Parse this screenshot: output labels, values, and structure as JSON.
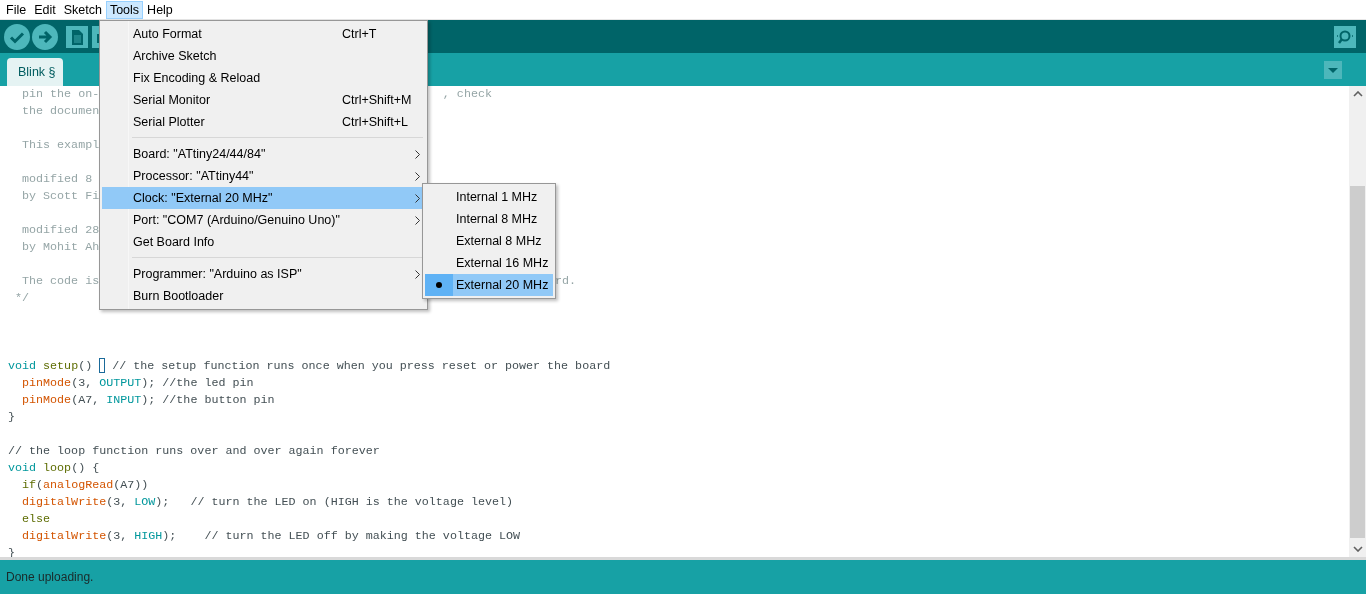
{
  "menu_bar": [
    {
      "label": "File",
      "selected": false
    },
    {
      "label": "Edit",
      "selected": false
    },
    {
      "label": "Sketch",
      "selected": false
    },
    {
      "label": "Tools",
      "selected": true
    },
    {
      "label": "Help",
      "selected": false
    }
  ],
  "toolbar": {
    "buttons": [
      {
        "kind": "verify"
      },
      {
        "kind": "upload"
      },
      {
        "kind": "new"
      },
      {
        "kind": "open"
      }
    ]
  },
  "tabs": [
    {
      "label": "Blink §",
      "selected": true
    }
  ],
  "editor": {
    "lines": [
      {
        "kind": "code",
        "tokens": [
          {
            "kind": "doc",
            "s": "  pin the on-"
          }
        ],
        "tail": ", check"
      },
      {
        "kind": "code",
        "tokens": [
          {
            "kind": "doc",
            "s": "  the documen"
          }
        ]
      },
      {
        "kind": "blank"
      },
      {
        "kind": "code",
        "tokens": [
          {
            "kind": "doc",
            "s": "  This exampl"
          }
        ]
      },
      {
        "kind": "blank"
      },
      {
        "kind": "code",
        "tokens": [
          {
            "kind": "doc",
            "s": "  modified 8"
          }
        ]
      },
      {
        "kind": "code",
        "tokens": [
          {
            "kind": "doc",
            "s": "  by Scott Fi"
          }
        ]
      },
      {
        "kind": "blank"
      },
      {
        "kind": "code",
        "tokens": [
          {
            "kind": "doc",
            "s": "  modified 28"
          }
        ]
      },
      {
        "kind": "code",
        "tokens": [
          {
            "kind": "doc",
            "s": "  by Mohit Ah"
          }
        ]
      },
      {
        "kind": "blank"
      },
      {
        "kind": "code",
        "tokens": [
          {
            "kind": "doc",
            "s": "  The code is"
          }
        ],
        "tail": "rd."
      },
      {
        "kind": "code",
        "tokens": [
          {
            "kind": "doc",
            "s": " */"
          }
        ]
      },
      {
        "kind": "blank"
      },
      {
        "kind": "blank"
      },
      {
        "kind": "blank"
      },
      {
        "kind": "code",
        "tokens": [
          {
            "kind": "type",
            "s": "void"
          },
          {
            "kind": "func",
            "s": " setup"
          },
          {
            "kind": "text",
            "s": "() "
          },
          {
            "kind": "cursor"
          },
          {
            "kind": "text",
            "s": " // the setup function runs once when you press reset or power the board"
          }
        ]
      },
      {
        "kind": "code",
        "tokens": [
          {
            "kind": "builtin",
            "s": "  pinMode"
          },
          {
            "kind": "text",
            "s": "(3, "
          },
          {
            "kind": "const",
            "s": "OUTPUT"
          },
          {
            "kind": "text",
            "s": "); //the led pin"
          }
        ]
      },
      {
        "kind": "code",
        "tokens": [
          {
            "kind": "builtin",
            "s": "  pinMode"
          },
          {
            "kind": "text",
            "s": "(A7, "
          },
          {
            "kind": "const",
            "s": "INPUT"
          },
          {
            "kind": "text",
            "s": "); //the button pin"
          }
        ]
      },
      {
        "kind": "code",
        "tokens": [
          {
            "kind": "text",
            "s": "}"
          }
        ]
      },
      {
        "kind": "blank"
      },
      {
        "kind": "code",
        "tokens": [
          {
            "kind": "text",
            "s": "// the loop function runs over and over again forever"
          }
        ]
      },
      {
        "kind": "code",
        "tokens": [
          {
            "kind": "type",
            "s": "void"
          },
          {
            "kind": "func",
            "s": " loop"
          },
          {
            "kind": "text",
            "s": "() {"
          }
        ]
      },
      {
        "kind": "code",
        "tokens": [
          {
            "kind": "func",
            "s": "  if"
          },
          {
            "kind": "text",
            "s": "("
          },
          {
            "kind": "builtin",
            "s": "analogRead"
          },
          {
            "kind": "text",
            "s": "(A7))"
          }
        ]
      },
      {
        "kind": "code",
        "tokens": [
          {
            "kind": "builtin",
            "s": "  digitalWrite"
          },
          {
            "kind": "text",
            "s": "(3, "
          },
          {
            "kind": "const",
            "s": "LOW"
          },
          {
            "kind": "text",
            "s": ");   // turn the LED on (HIGH is the voltage level)"
          }
        ]
      },
      {
        "kind": "code",
        "tokens": [
          {
            "kind": "func",
            "s": "  else"
          }
        ]
      },
      {
        "kind": "code",
        "tokens": [
          {
            "kind": "builtin",
            "s": "  digitalWrite"
          },
          {
            "kind": "text",
            "s": "(3, "
          },
          {
            "kind": "const",
            "s": "HIGH"
          },
          {
            "kind": "text",
            "s": ");    // turn the LED off by making the voltage LOW"
          }
        ]
      },
      {
        "kind": "code",
        "tokens": [
          {
            "kind": "text",
            "s": "}"
          }
        ]
      }
    ]
  },
  "tools_menu": {
    "items": [
      {
        "kind": "item",
        "label": "Auto Format",
        "shortcut": "Ctrl+T",
        "submenu": false,
        "selected": false
      },
      {
        "kind": "item",
        "label": "Archive Sketch",
        "submenu": false,
        "selected": false
      },
      {
        "kind": "item",
        "label": "Fix Encoding & Reload",
        "submenu": false,
        "selected": false
      },
      {
        "kind": "item",
        "label": "Serial Monitor",
        "shortcut": "Ctrl+Shift+M",
        "submenu": false,
        "selected": false
      },
      {
        "kind": "item",
        "label": "Serial Plotter",
        "shortcut": "Ctrl+Shift+L",
        "submenu": false,
        "selected": false
      },
      {
        "kind": "separator"
      },
      {
        "kind": "item",
        "label": "Board: \"ATtiny24/44/84\"",
        "submenu": true,
        "selected": false
      },
      {
        "kind": "item",
        "label": "Processor: \"ATtiny44\"",
        "submenu": true,
        "selected": false
      },
      {
        "kind": "item",
        "label": "Clock: \"External 20 MHz\"",
        "submenu": true,
        "selected": true
      },
      {
        "kind": "item",
        "label": "Port: \"COM7 (Arduino/Genuino Uno)\"",
        "submenu": true,
        "selected": false
      },
      {
        "kind": "item",
        "label": "Get Board Info",
        "submenu": false,
        "selected": false
      },
      {
        "kind": "separator"
      },
      {
        "kind": "item",
        "label": "Programmer: \"Arduino as ISP\"",
        "submenu": true,
        "selected": false
      },
      {
        "kind": "item",
        "label": "Burn Bootloader",
        "submenu": false,
        "selected": false
      }
    ]
  },
  "clock_submenu": {
    "items": [
      {
        "label": "Internal 1 MHz",
        "checked": false,
        "selected": false
      },
      {
        "label": "Internal 8 MHz",
        "checked": false,
        "selected": false
      },
      {
        "label": "External 8 MHz",
        "checked": false,
        "selected": false
      },
      {
        "label": "External 16 MHz",
        "checked": false,
        "selected": false
      },
      {
        "label": "External 20 MHz",
        "checked": true,
        "selected": true
      }
    ]
  },
  "status_bar": {
    "message": "Done uploading."
  }
}
